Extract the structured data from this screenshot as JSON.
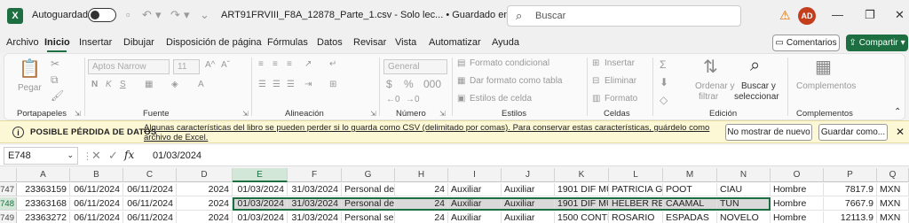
{
  "app": {
    "logo": "X",
    "autosave_label": "Autoguardado",
    "doc_title": "ART91FRVIII_F8A_12878_Parte_1.csv  -  Solo lec...  •  Guardado en Este PC",
    "search_placeholder": "Buscar",
    "avatar_initials": "AD"
  },
  "menu": {
    "tabs": [
      "Archivo",
      "Inicio",
      "Insertar",
      "Dibujar",
      "Disposición de página",
      "Fórmulas",
      "Datos",
      "Revisar",
      "Vista",
      "Automatizar",
      "Ayuda"
    ],
    "comments_label": "Comentarios",
    "share_label": "Compartir"
  },
  "ribbon": {
    "groups": [
      "Portapapeles",
      "Fuente",
      "Alineación",
      "Número",
      "Estilos",
      "Celdas",
      "Edición",
      "Complementos"
    ],
    "paste": "Pegar",
    "font_name": "Aptos Narrow",
    "font_size": "11",
    "number_format": "General",
    "cond_format": "Formato condicional",
    "table_format": "Dar formato como tabla",
    "cell_styles": "Estilos de celda",
    "insert": "Insertar",
    "delete": "Eliminar",
    "format": "Formato",
    "sort_filter_1": "Ordenar y",
    "sort_filter_2": "filtrar",
    "find_select_1": "Buscar y",
    "find_select_2": "seleccionar",
    "addins": "Complementos"
  },
  "warning": {
    "title": "POSIBLE PÉRDIDA DE DATOS",
    "message": "Algunas características del libro se pueden perder si lo guarda como CSV (delimitado por comas). Para conservar estas características, guárdelo como archivo de Excel.",
    "btn_dismiss": "No mostrar de nuevo",
    "btn_save_as": "Guardar como..."
  },
  "formula": {
    "cell_ref": "E748",
    "value": "01/03/2024"
  },
  "grid": {
    "columns": [
      "A",
      "B",
      "C",
      "D",
      "E",
      "F",
      "G",
      "H",
      "I",
      "J",
      "K",
      "L",
      "M",
      "N",
      "O",
      "P",
      "Q"
    ],
    "rows": [
      {
        "num": "747",
        "cells": [
          "23363159",
          "06/11/2024",
          "06/11/2024",
          "2024",
          "01/03/2024",
          "31/03/2024",
          "Personal de",
          "24",
          "Auxiliar",
          "Auxiliar",
          "1901 DIF MUI",
          "PATRICIA GU",
          "POOT",
          "CIAU",
          "Hombre",
          "7817.9",
          "MXN"
        ]
      },
      {
        "num": "748",
        "cells": [
          "23363168",
          "06/11/2024",
          "06/11/2024",
          "2024",
          "01/03/2024",
          "31/03/2024",
          "Personal de",
          "24",
          "Auxiliar",
          "Auxiliar",
          "1901 DIF MUI",
          "HELBER REYE",
          "CAAMAL",
          "TUN",
          "Hombre",
          "7667.9",
          "MXN"
        ]
      },
      {
        "num": "749",
        "cells": [
          "23363272",
          "06/11/2024",
          "06/11/2024",
          "2024",
          "01/03/2024",
          "31/03/2024",
          "Personal serv",
          "24",
          "Auxiliar",
          "Auxiliar",
          "1500 CONTR",
          "ROSARIO",
          "ESPADAS",
          "NOVELO",
          "Hombre",
          "12113.9",
          "MXN"
        ]
      }
    ]
  }
}
